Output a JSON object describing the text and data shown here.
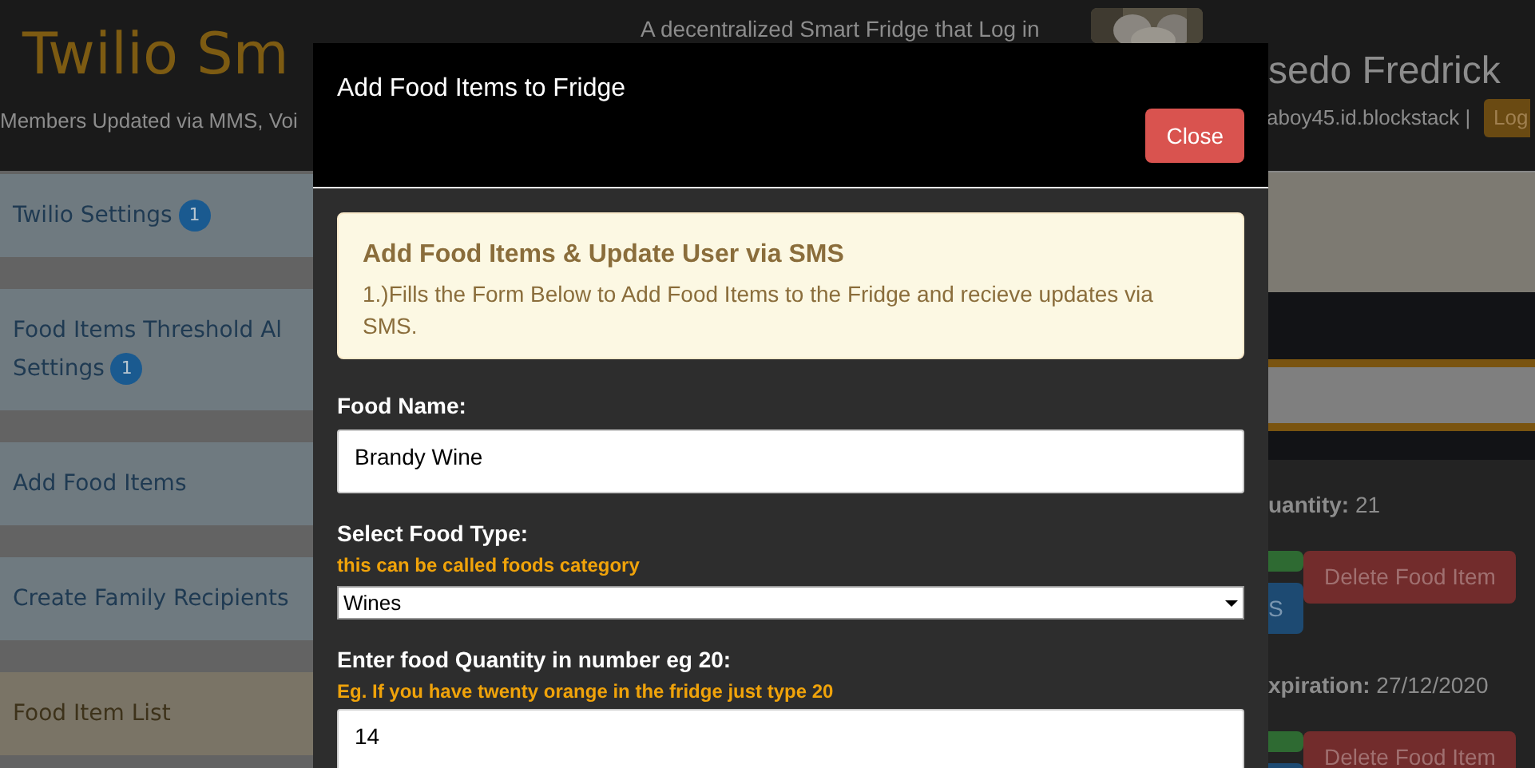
{
  "header": {
    "title": "Twilio Sm",
    "subtitle": "Members Updated via MMS, Voi",
    "tagline": "A decentralized Smart Fridge that Log in",
    "user_name": "sedo Fredrick",
    "user_id": "aboy45.id.blockstack |",
    "logout": "Log"
  },
  "sidebar": {
    "items": [
      {
        "label": "Twilio Settings",
        "badge": "1",
        "selected": false
      },
      {
        "label": "Food Items Threshold Al",
        "label_2": "Settings",
        "badge": "1",
        "selected": false
      },
      {
        "label": "Add Food Items",
        "selected": false
      },
      {
        "label": "Create Family Recipients",
        "selected": false
      },
      {
        "label": "Food Item List",
        "selected": true
      }
    ]
  },
  "food_cards": [
    {
      "detail": "**uantity:** 21",
      "side_button": "S",
      "delete": "Delete Food Item"
    },
    {
      "detail": "**xpiration:** 27/12/2020",
      "delete": "Delete Food Item"
    }
  ],
  "modal": {
    "title": "Add Food Items to Fridge",
    "close": "Close",
    "alert": {
      "title": "Add Food Items & Update User via SMS",
      "text": "1.)Fills the Form Below to Add Food Items to the Fridge and recieve updates via SMS."
    },
    "fields": [
      {
        "kind": "input",
        "label": "Food Name:",
        "value": "Brandy Wine"
      },
      {
        "kind": "select",
        "label": "Select Food Type:",
        "hint": "this can be called foods category",
        "value": "Wines"
      },
      {
        "kind": "input",
        "label": "Enter food Quantity in number eg 20:",
        "hint": "Eg. If you have twenty orange in the fridge just type 20",
        "value": "14"
      }
    ]
  }
}
